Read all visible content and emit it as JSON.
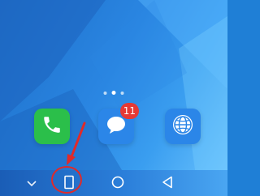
{
  "home_screen": {
    "page_indicator": {
      "count": 3,
      "active_index": 1
    },
    "dock": {
      "apps": [
        {
          "app": "phone",
          "icon": "phone-icon",
          "color": "#2bbf4a"
        },
        {
          "app": "messages",
          "icon": "message-icon",
          "color": "#2b86e8",
          "badge": "11"
        },
        {
          "app": "browser",
          "icon": "browser-icon",
          "color": "#2b86e8"
        }
      ]
    }
  },
  "navigation_bar": {
    "items": [
      {
        "icon": "chevron-down-icon"
      },
      {
        "icon": "recent-apps-icon"
      },
      {
        "icon": "home-icon"
      },
      {
        "icon": "back-icon"
      }
    ]
  },
  "annotation": {
    "color": "#e02a2a",
    "target": "recent-apps-button"
  }
}
